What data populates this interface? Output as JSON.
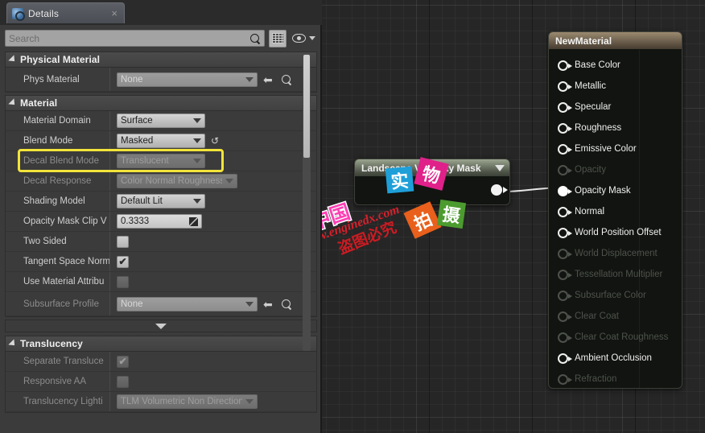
{
  "tab": {
    "title": "Details",
    "icon": "details-info-icon",
    "close": "×"
  },
  "search": {
    "value": "",
    "placeholder": "Search",
    "icons": [
      "search-icon",
      "grid-view-icon",
      "eye-icon",
      "chevron-down-icon"
    ]
  },
  "sections": [
    {
      "title": "Physical Material",
      "rows": [
        {
          "label": "Phys Material",
          "type": "object",
          "value": "None",
          "dim_label": false,
          "has_back": true,
          "has_browse": true
        }
      ]
    },
    {
      "title": "Material",
      "rows": [
        {
          "label": "Material Domain",
          "type": "combo",
          "value": "Surface",
          "dim_label": false,
          "disabled": false,
          "width": "w120"
        },
        {
          "label": "Blend Mode",
          "type": "combo",
          "value": "Masked",
          "dim_label": false,
          "disabled": false,
          "width": "w120",
          "has_reset": true,
          "highlighted": true
        },
        {
          "label": "Decal Blend Mode",
          "type": "combo",
          "value": "Translucent",
          "dim_label": true,
          "disabled": true,
          "width": "w120"
        },
        {
          "label": "Decal Response",
          "type": "combo",
          "value": "Color Normal Roughness",
          "dim_label": true,
          "disabled": true,
          "width": "w150"
        },
        {
          "label": "Shading Model",
          "type": "combo",
          "value": "Default Lit",
          "dim_label": false,
          "disabled": false,
          "width": "w120"
        },
        {
          "label": "Opacity Mask Clip V",
          "type": "number",
          "value": "0.3333",
          "dim_label": false
        },
        {
          "label": "Two Sided",
          "type": "check",
          "checked": false,
          "dim_label": false,
          "disabled": false
        },
        {
          "label": "Tangent Space Norm",
          "type": "check",
          "checked": true,
          "dim_label": false,
          "disabled": false
        },
        {
          "label": "Use Material Attribu",
          "type": "check",
          "checked": false,
          "dim_label": false,
          "disabled": true
        },
        {
          "label": "Subsurface Profile",
          "type": "object",
          "value": "None",
          "dim_label": true,
          "has_back": true,
          "has_browse": true
        }
      ]
    },
    {
      "title": "Translucency",
      "rows": [
        {
          "label": "Separate Transluce",
          "type": "check",
          "checked": true,
          "dim_label": true,
          "disabled": true
        },
        {
          "label": "Responsive AA",
          "type": "check",
          "checked": false,
          "dim_label": true,
          "disabled": true
        },
        {
          "label": "Translucency Lighti",
          "type": "combo",
          "value": "TLM Volumetric Non Directional",
          "dim_label": true,
          "disabled": true,
          "width": "w175"
        }
      ]
    }
  ],
  "highlight": {
    "color": "#f2e43a",
    "target": "Blend Mode"
  },
  "graph": {
    "nodes": [
      {
        "id": "landscape-visibility-mask",
        "title": "Landscape Visibility Mask",
        "output_pin": "output"
      },
      {
        "id": "new-material",
        "title": "NewMaterial",
        "inputs": [
          {
            "label": "Base Color",
            "enabled": true,
            "connected": false
          },
          {
            "label": "Metallic",
            "enabled": true,
            "connected": false
          },
          {
            "label": "Specular",
            "enabled": true,
            "connected": false
          },
          {
            "label": "Roughness",
            "enabled": true,
            "connected": false
          },
          {
            "label": "Emissive Color",
            "enabled": true,
            "connected": false
          },
          {
            "label": "Opacity",
            "enabled": false,
            "connected": false
          },
          {
            "label": "Opacity Mask",
            "enabled": true,
            "connected": true
          },
          {
            "label": "Normal",
            "enabled": true,
            "connected": false
          },
          {
            "label": "World Position Offset",
            "enabled": true,
            "connected": false
          },
          {
            "label": "World Displacement",
            "enabled": false,
            "connected": false
          },
          {
            "label": "Tessellation Multiplier",
            "enabled": false,
            "connected": false
          },
          {
            "label": "Subsurface Color",
            "enabled": false,
            "connected": false
          },
          {
            "label": "Clear Coat",
            "enabled": false,
            "connected": false
          },
          {
            "label": "Clear Coat Roughness",
            "enabled": false,
            "connected": false
          },
          {
            "label": "Ambient Occlusion",
            "enabled": true,
            "connected": false
          },
          {
            "label": "Refraction",
            "enabled": false,
            "connected": false
          }
        ]
      }
    ],
    "wire": {
      "from": "landscape-visibility-mask.output",
      "to": "new-material.Opacity Mask"
    }
  },
  "watermarks": {
    "brand": "引擎中国",
    "url": "www.enginedx.com",
    "notice": "盗图必究",
    "tiles": [
      "实",
      "物",
      "拍",
      "摄"
    ]
  }
}
